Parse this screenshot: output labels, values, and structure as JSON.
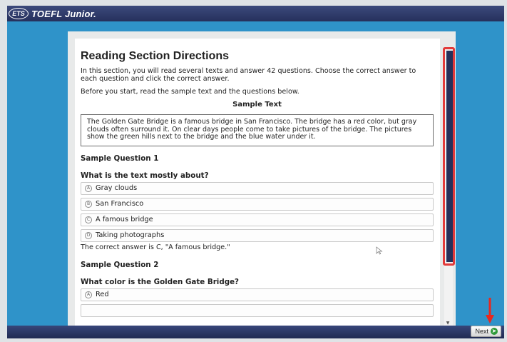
{
  "app": {
    "logo_mark": "ETS",
    "title": "TOEFL Junior."
  },
  "reading": {
    "heading": "Reading Section Directions",
    "intro": "In this section, you will read several texts and answer 42 questions. Choose the correct answer to each question and click the correct answer.",
    "before": "Before you start, read the sample text and the questions below.",
    "sample_title": "Sample Text",
    "sample_text": "The Golden Gate Bridge is a famous bridge in San Francisco. The bridge has a red color, but gray clouds often surround it. On clear days people come to take pictures of the bridge. The pictures show the green hills next to the bridge and the blue water under it.",
    "q1": {
      "heading": "Sample Question 1",
      "text": "What is the text mostly about?",
      "options": [
        {
          "letter": "A",
          "label": "Gray clouds"
        },
        {
          "letter": "B",
          "label": "San Francisco"
        },
        {
          "letter": "C",
          "label": "A famous bridge"
        },
        {
          "letter": "D",
          "label": "Taking photographs"
        }
      ],
      "answer": "The correct answer is C, \"A famous bridge.\""
    },
    "q2": {
      "heading": "Sample Question 2",
      "text": "What color is the Golden Gate Bridge?",
      "options": [
        {
          "letter": "A",
          "label": "Red"
        }
      ]
    }
  },
  "toolbar": {
    "next_label": "Next"
  },
  "icons": {
    "next": "arrow-right-circle-icon",
    "scroll_down": "chevron-down-icon",
    "cursor": "mouse-pointer-icon",
    "annotation": "red-arrow-icon"
  },
  "colors": {
    "screen_background": "#2f93c9",
    "title_bar": "#2c3868",
    "scroll_thumb": "#25305a",
    "highlight": "#e23a3a",
    "next_icon": "#2f9a3a"
  }
}
